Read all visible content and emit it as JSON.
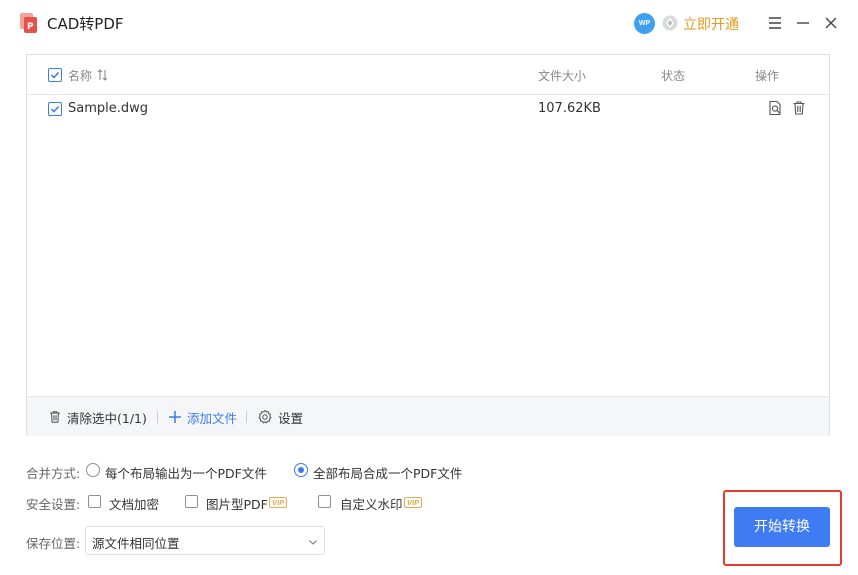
{
  "app": {
    "title": "CAD转PDF"
  },
  "header": {
    "avatar_text": "WP",
    "vip_link": "立即开通"
  },
  "table": {
    "columns": {
      "name": "名称",
      "size": "文件大小",
      "status": "状态",
      "actions": "操作"
    },
    "rows": [
      {
        "name": "Sample.dwg",
        "size": "107.62KB",
        "status": ""
      }
    ]
  },
  "footer": {
    "clear": "清除选中(1/1)",
    "add": "添加文件",
    "settings": "设置"
  },
  "options": {
    "merge_label": "合并方式:",
    "merge_each": "每个布局输出为一个PDF文件",
    "merge_all": "全部布局合成一个PDF文件",
    "security_label": "安全设置:",
    "encrypt": "文档加密",
    "image_pdf": "图片型PDF",
    "watermark": "自定义水印",
    "vip": "VIP",
    "save_label": "保存位置:",
    "save_value": "源文件相同位置"
  },
  "start_button": "开始转换",
  "colors": {
    "accent": "#3f7bf3",
    "vip": "#e39a22",
    "highlight": "#e53b2a",
    "logo": "#e8514a"
  }
}
